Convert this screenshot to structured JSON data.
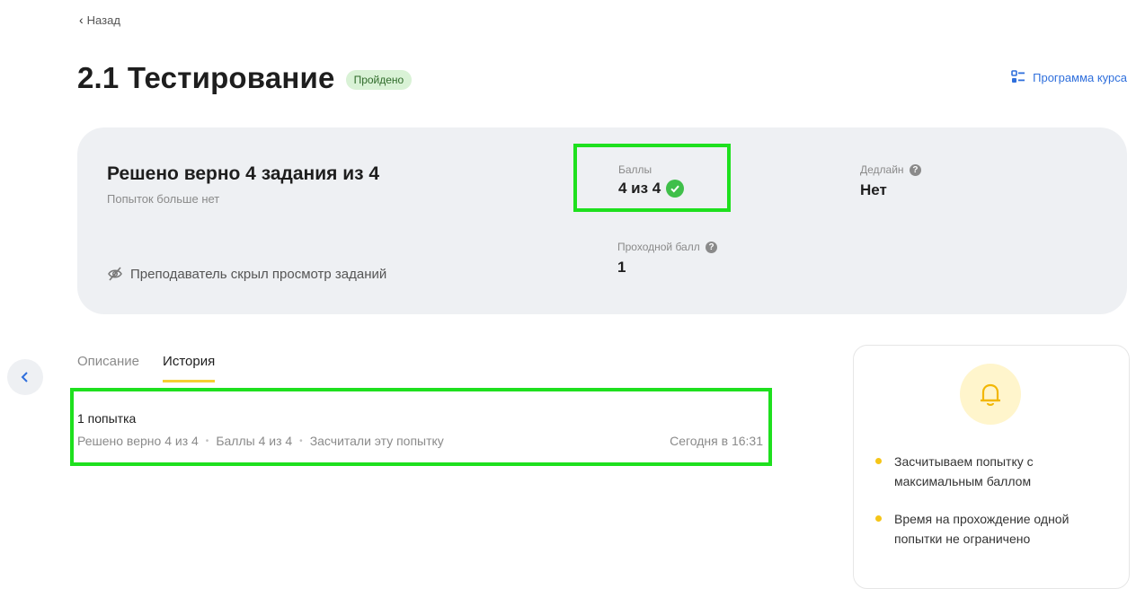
{
  "nav": {
    "back_label": "Назад"
  },
  "header": {
    "title": "2.1 Тестирование",
    "status_badge": "Пройдено",
    "program_link": "Программа курса"
  },
  "summary": {
    "solved_text": "Решено верно 4 задания из 4",
    "attempts_text": "Попыток больше нет",
    "hidden_note": "Преподаватель скрыл просмотр заданий",
    "score_label": "Баллы",
    "score_value": "4 из 4",
    "deadline_label": "Дедлайн",
    "deadline_value": "Нет",
    "pass_label": "Проходной балл",
    "pass_value": "1"
  },
  "tabs": [
    {
      "label": "Описание",
      "active": false
    },
    {
      "label": "История",
      "active": true
    }
  ],
  "history": {
    "title": "1 попытка",
    "solved": "Решено верно 4 из 4",
    "score": "Баллы 4 из 4",
    "counted": "Засчитали эту попытку",
    "time": "Сегодня в 16:31"
  },
  "info": {
    "rules": [
      "Засчитываем попытку с максимальным баллом",
      "Время на прохождение одной попытки не ограничено"
    ]
  },
  "colors": {
    "highlight": "#1ee01e",
    "accent_link": "#2f6fdc",
    "tab_underline": "#f5cf32",
    "success": "#3fbf4a"
  }
}
